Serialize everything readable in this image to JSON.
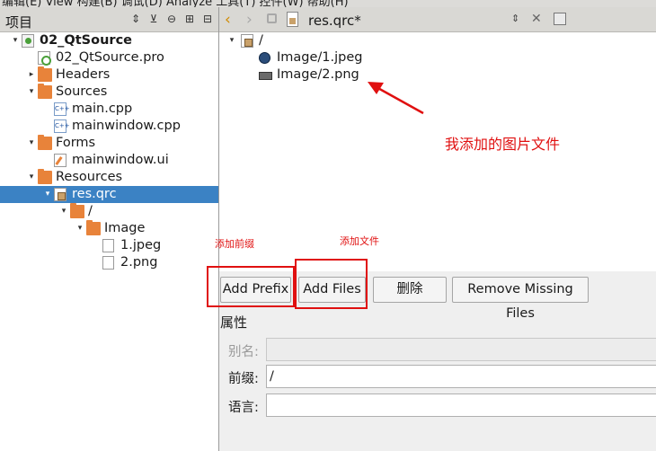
{
  "menubar": {
    "text": "编辑(E)   View   构建(B)   调试(D)   Analyze   工具(T)   控件(W)   帮助(H)"
  },
  "left_panel": {
    "title": "项目",
    "header_icons": [
      "sort-icon",
      "filter-icon",
      "link-icon",
      "split-add-icon",
      "close-pane-icon"
    ],
    "tree": [
      {
        "label": "02_QtSource",
        "bold": true,
        "depth": 0,
        "expander": "▾",
        "icon": "proj"
      },
      {
        "label": "02_QtSource.pro",
        "depth": 1,
        "expander": "",
        "icon": "pro"
      },
      {
        "label": "Headers",
        "depth": 1,
        "expander": "▸",
        "icon": "folder"
      },
      {
        "label": "Sources",
        "depth": 1,
        "expander": "▾",
        "icon": "folder"
      },
      {
        "label": "main.cpp",
        "depth": 2,
        "expander": "",
        "icon": "cpp"
      },
      {
        "label": "mainwindow.cpp",
        "depth": 2,
        "expander": "",
        "icon": "cpp"
      },
      {
        "label": "Forms",
        "depth": 1,
        "expander": "▾",
        "icon": "folder"
      },
      {
        "label": "mainwindow.ui",
        "depth": 2,
        "expander": "",
        "icon": "ui"
      },
      {
        "label": "Resources",
        "depth": 1,
        "expander": "▾",
        "icon": "folder"
      },
      {
        "label": "res.qrc",
        "depth": 2,
        "expander": "▾",
        "icon": "qrc",
        "selected": true
      },
      {
        "label": "/",
        "depth": 3,
        "expander": "▾",
        "icon": "folder"
      },
      {
        "label": "Image",
        "depth": 4,
        "expander": "▾",
        "icon": "folder"
      },
      {
        "label": "1.jpeg",
        "depth": 5,
        "expander": "",
        "icon": "file"
      },
      {
        "label": "2.png",
        "depth": 5,
        "expander": "",
        "icon": "file"
      }
    ]
  },
  "editor": {
    "doc_title": "res.qrc*",
    "resource_tree": [
      {
        "label": "/",
        "depth": 0,
        "expander": "▾",
        "icon": "qrc"
      },
      {
        "label": "Image/1.jpeg",
        "depth": 1,
        "expander": "",
        "icon": "jpeg"
      },
      {
        "label": "Image/2.png",
        "depth": 1,
        "expander": "",
        "icon": "png"
      }
    ],
    "buttons": {
      "add_prefix": "Add Prefix",
      "add_files": "Add Files",
      "delete": "删除",
      "remove_missing": "Remove Missing Files"
    },
    "properties": {
      "title": "属性",
      "alias_label": "别名:",
      "alias_value": "",
      "prefix_label": "前缀:",
      "prefix_value": "/",
      "language_label": "语言:",
      "language_value": ""
    }
  },
  "annotations": {
    "added_images": "我添加的图片文件",
    "add_prefix_note": "添加前缀",
    "add_files_note": "添加文件",
    "color": "#e01010"
  }
}
